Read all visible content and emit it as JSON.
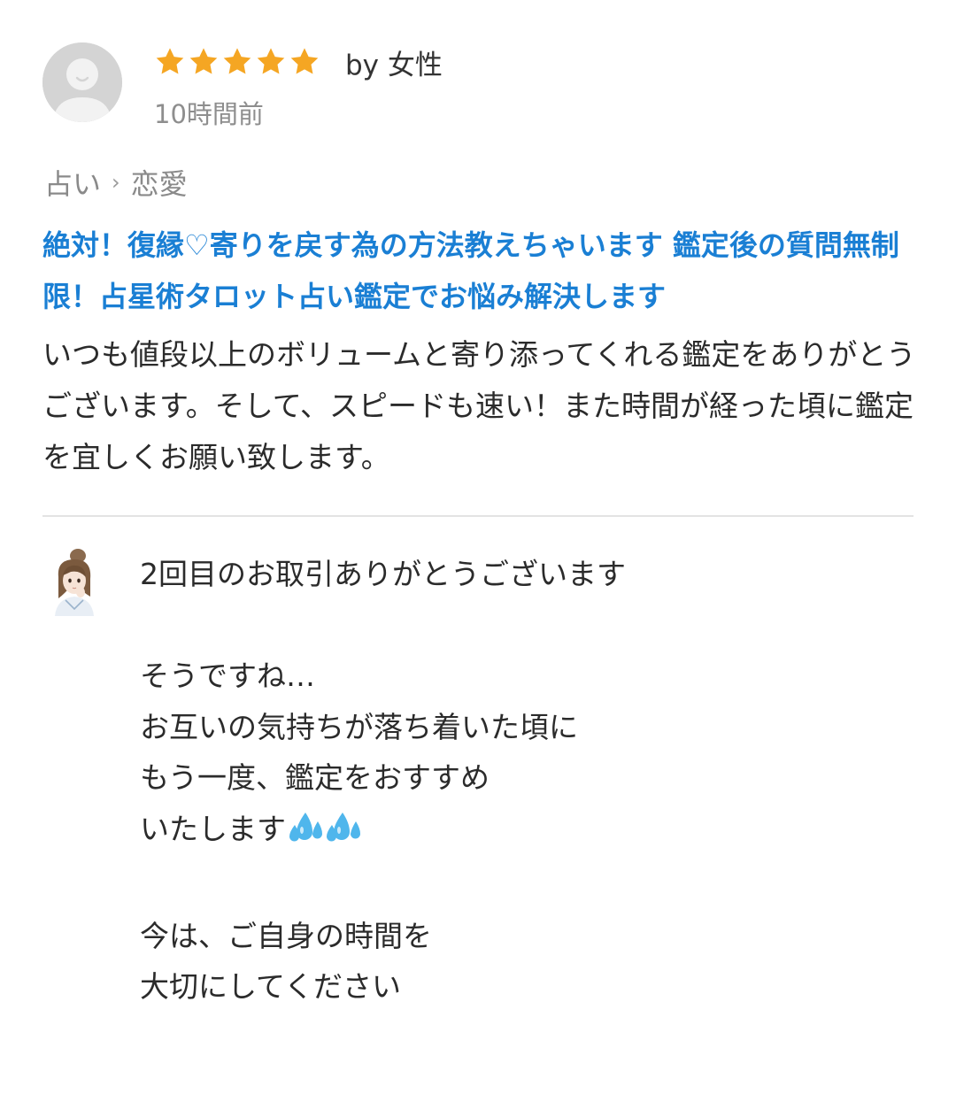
{
  "review": {
    "rating": 5,
    "max_rating": 5,
    "star_color": "#f5a623",
    "author_label": "by 女性",
    "time_ago": "10時間前",
    "avatar_icon": "default-user-avatar"
  },
  "breadcrumb": {
    "items": [
      "占い",
      "恋愛"
    ],
    "separator": "›"
  },
  "service": {
    "title": "絶対！復縁♡寄りを戻す為の方法教えちゃいます 鑑定後の質問無制限！占星術タロット占い鑑定でお悩み解決します",
    "title_color": "#1a7fd4"
  },
  "review_body": "いつも値段以上のボリュームと寄り添ってくれる鑑定をありがとうございます。そして、スピードも速い！また時間が経った頃に鑑定を宜しくお願い致します。",
  "seller_reply": {
    "avatar_icon": "seller-avatar-illustration",
    "lines": [
      "2回目のお取引ありがとうございます",
      "",
      "そうですね…",
      "お互いの気持ちが落ち着いた頃に",
      "もう一度、鑑定をおすすめ",
      "いたします",
      "",
      "今は、ご自身の時間を",
      "大切にしてください"
    ],
    "emoji_icon": "sweat-droplets-icon"
  }
}
